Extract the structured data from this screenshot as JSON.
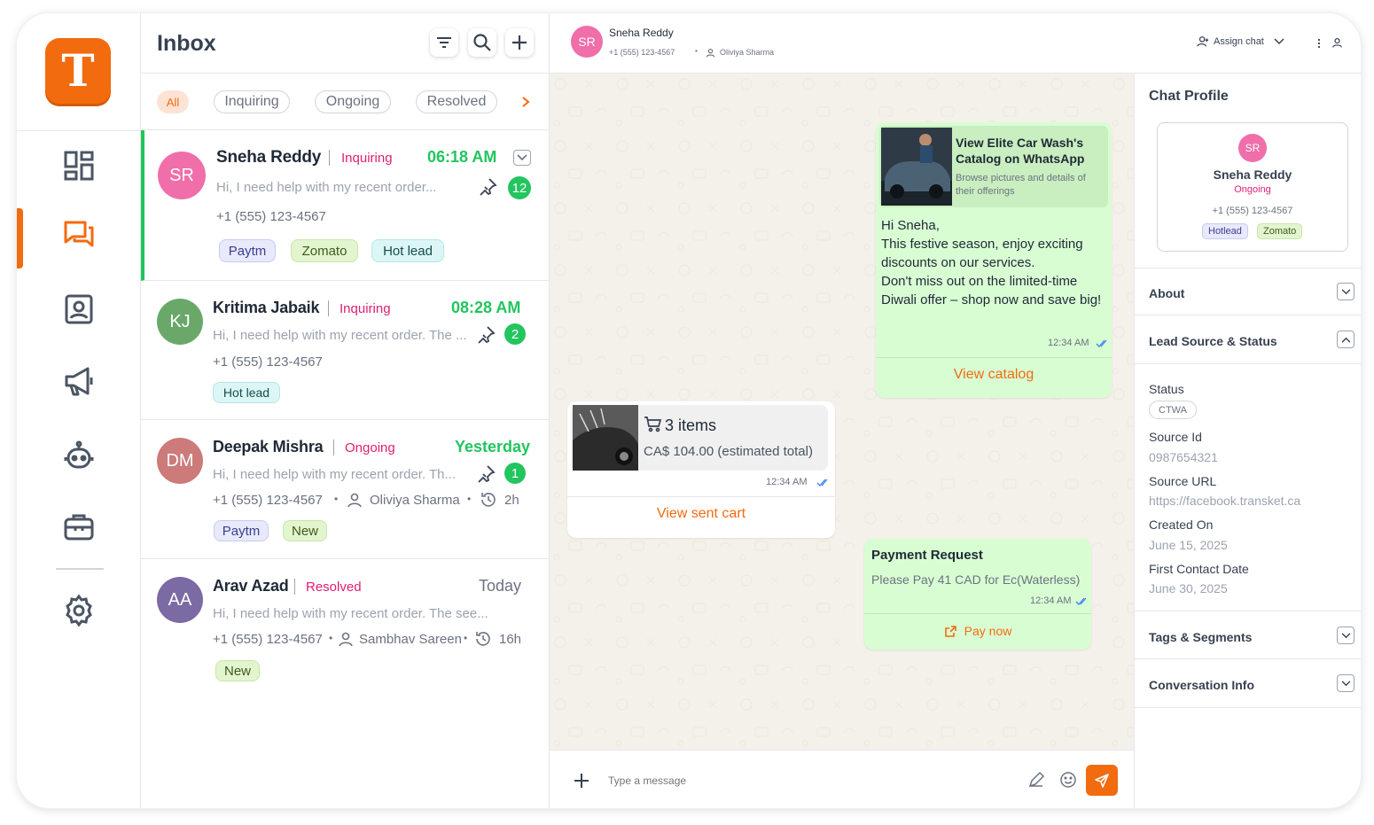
{
  "logo": {
    "letter": "T"
  },
  "nav": [
    "dashboard-icon",
    "chat-icon",
    "contacts-icon",
    "megaphone-icon",
    "bot-icon",
    "briefcase-icon",
    "settings-icon"
  ],
  "inbox": {
    "title": "Inbox",
    "filters": [
      "All",
      "Inquiring",
      "Ongoing",
      "Resolved"
    ],
    "conversations": [
      {
        "initials": "SR",
        "name": "Sneha Reddy",
        "status": "Inquiring",
        "time": "06:18 AM",
        "message": "Hi, I need help with my recent order...",
        "phone": "+1 (555) 123-4567",
        "unread": "12",
        "tags": [
          "Paytm",
          "Zomato",
          "Hot lead"
        ],
        "avatar_color": "#f06eaa"
      },
      {
        "initials": "KJ",
        "name": "Kritima Jabaik",
        "status": "Inquiring",
        "time": "08:28 AM",
        "message": "Hi, I need help with my recent order. The ...",
        "phone": "+1 (555) 123-4567",
        "unread": "2",
        "tags": [
          "Hot lead"
        ],
        "avatar_color": "#6aa86a"
      },
      {
        "initials": "DM",
        "name": "Deepak Mishra",
        "status": "Ongoing",
        "time": "Yesterday",
        "message": "Hi, I need help with my recent order. Th...",
        "phone": "+1 (555) 123-4567",
        "agent": "Oliviya Sharma",
        "ago": "2h",
        "unread": "1",
        "tags": [
          "Paytm",
          "New"
        ],
        "avatar_color": "#cc7a7a"
      },
      {
        "initials": "AA",
        "name": "Arav Azad",
        "status": "Resolved",
        "time": "Today",
        "message": "Hi, I need help with my recent order. The see...",
        "phone": "+1 (555) 123-4567",
        "agent": "Sambhav Sareen",
        "ago": "16h",
        "tags": [
          "New"
        ],
        "avatar_color": "#7b6aa3"
      }
    ]
  },
  "chat": {
    "contact_initials": "SR",
    "contact_name": "Sneha Reddy",
    "contact_phone": "+1 (555) 123-4567",
    "agent": "Oliviya Sharma",
    "assign_label": "Assign chat",
    "catalog": {
      "title": "View Elite Car Wash's Catalog on WhatsApp",
      "subtitle": "Browse pictures and details of their offerings",
      "body": "Hi Sneha,\nThis festive season, enjoy exciting discounts on our services.\nDon't miss out on the limited-time Diwali offer – shop now and save big!",
      "time": "12:34 AM",
      "action": "View catalog"
    },
    "cart": {
      "items": "3 items",
      "total": "CA$ 104.00 (estimated total)",
      "time": "12:34 AM",
      "action": "View sent cart"
    },
    "payment": {
      "title": "Payment Request",
      "body": "Please Pay 41 CAD for Ec(Waterless)",
      "time": "12:34 AM",
      "action": "Pay now"
    },
    "composer_placeholder": "Type a message"
  },
  "profile": {
    "title": "Chat Profile",
    "initials": "SR",
    "name": "Sneha Reddy",
    "status": "Ongoing",
    "phone": "+1 (555) 123-4567",
    "tags": [
      "Hotlead",
      "Zomato"
    ],
    "sections": {
      "about": "About",
      "lead": "Lead Source & Status",
      "tags": "Tags & Segments",
      "conv": "Conversation Info"
    },
    "lead": {
      "status_label": "Status",
      "status_value": "CTWA",
      "source_id_label": "Source Id",
      "source_id": "0987654321",
      "source_url_label": "Source URL",
      "source_url": "https://facebook.transket.ca",
      "created_label": "Created On",
      "created": "June 15, 2025",
      "first_contact_label": "First Contact Date",
      "first_contact": "June 30, 2025"
    }
  },
  "colors": {
    "accent": "#f26b0f",
    "green": "#22c55e",
    "inquiring": "#e11d74",
    "ongoing": "#e11d74",
    "resolved": "#e11d74"
  }
}
